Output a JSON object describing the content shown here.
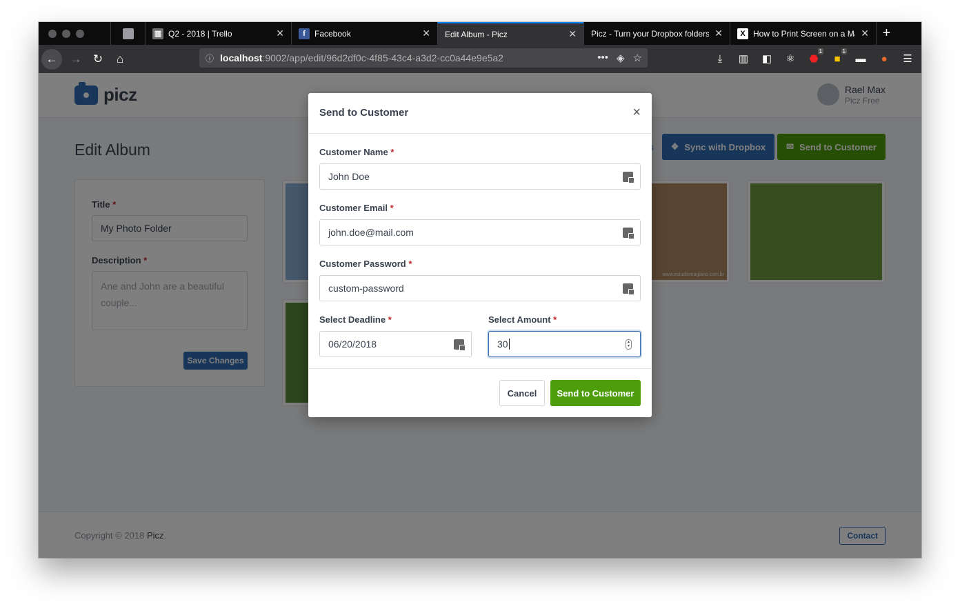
{
  "browser": {
    "tabs": [
      {
        "title": "Q2 - 2018 | Trello",
        "icon": "trello-icon"
      },
      {
        "title": "Facebook",
        "icon": "facebook-icon"
      },
      {
        "title": "Edit Album - Picz",
        "active": true
      },
      {
        "title": "Picz - Turn your Dropbox folders"
      },
      {
        "title": "How to Print Screen on a Mac",
        "icon": "x-icon"
      }
    ],
    "url_host": "localhost",
    "url_path": ":9002/app/edit/96d2df0c-4f85-43c4-a3d2-cc0a44e9e5a2",
    "badge_abp": "1",
    "badge_ext": "1"
  },
  "app": {
    "brand": "picz",
    "user_name": "Rael Max",
    "user_plan": "Picz Free",
    "page_title": "Edit Album",
    "sync_button": "Sync with Dropbox",
    "send_button": "Send to Customer",
    "link_partial": "s",
    "form": {
      "title_label": "Title",
      "title_value": "My Photo Folder",
      "description_label": "Description",
      "description_placeholder": "Ane and John are a beautiful couple...",
      "save_label": "Save Changes"
    },
    "footer_copyright": "Copyright © 2018 ",
    "footer_brand": "Picz",
    "footer_dot": ".",
    "contact_label": "Contact",
    "photo_caption": "www.estudiomagiano.com.br"
  },
  "modal": {
    "title": "Send to Customer",
    "close": "×",
    "customer_name_label": "Customer Name",
    "customer_name_value": "John Doe",
    "customer_email_label": "Customer Email",
    "customer_email_value": "john.doe@mail.com",
    "customer_password_label": "Customer Password",
    "customer_password_value": "custom-password",
    "deadline_label": "Select Deadline",
    "deadline_value": "06/20/2018",
    "amount_label": "Select Amount",
    "amount_value": "30",
    "required_mark": "*",
    "cancel_label": "Cancel",
    "submit_label": "Send to Customer"
  }
}
